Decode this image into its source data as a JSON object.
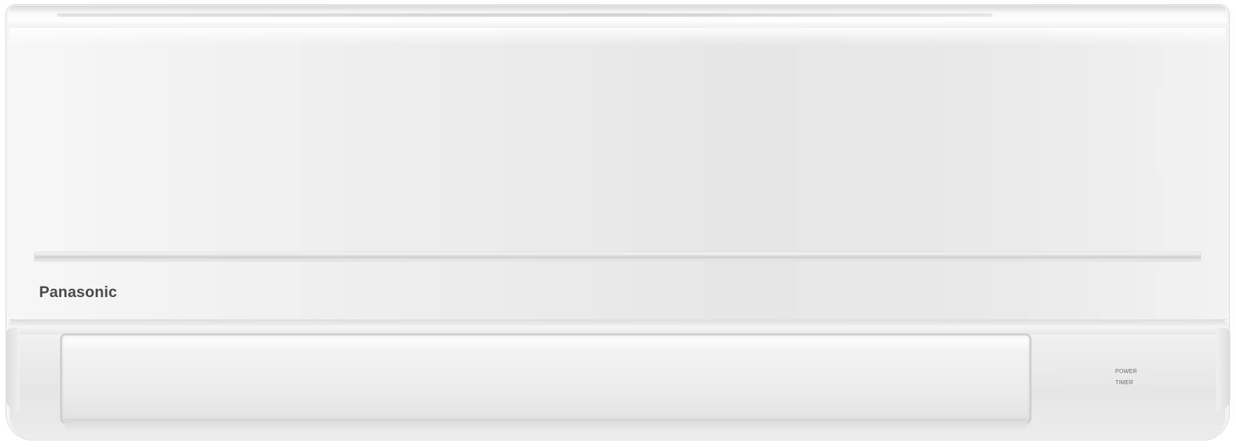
{
  "product": {
    "brand": "Panasonic",
    "indicators": {
      "power_label": "POWER",
      "timer_label": "TIMER"
    }
  }
}
